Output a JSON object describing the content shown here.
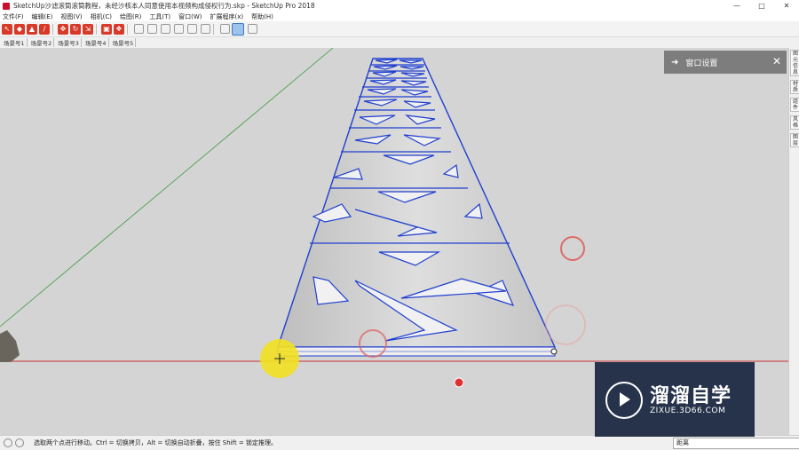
{
  "window": {
    "title": "SketchUp沙滤滚筒滚筒教程，未经沙核本人同意使用本视频构成侵权行为.skp - SketchUp Pro 2018",
    "controls": [
      "—",
      "□",
      "✕"
    ]
  },
  "menu": [
    "文件(F)",
    "编辑(E)",
    "视图(V)",
    "相机(C)",
    "绘图(R)",
    "工具(T)",
    "窗口(W)",
    "扩展程序(x)",
    "帮助(H)"
  ],
  "scenes": [
    "场景号1",
    "场景号2",
    "场景号3",
    "场景号4",
    "场景号5"
  ],
  "panel": {
    "title": "窗口设置",
    "arrow": "➜",
    "close": "✕"
  },
  "right_tabs": [
    "图元信息",
    "材质",
    "组件",
    "风格",
    "图层"
  ],
  "status": {
    "hint": "选取两个点进行移动。Ctrl = 切换拷贝，Alt = 切换自动折叠，按住 Shift = 锁定推理。",
    "measure_label": "距离"
  },
  "watermark": {
    "brand": "溜溜自学",
    "url": "ZIXUE.3D66.COM"
  },
  "colors": {
    "accent": "#c8102e",
    "selection": "#1f3fd0",
    "viewport": "#d4d4d4",
    "red_axis": "#c83232",
    "green_axis": "#3a9a3a"
  }
}
